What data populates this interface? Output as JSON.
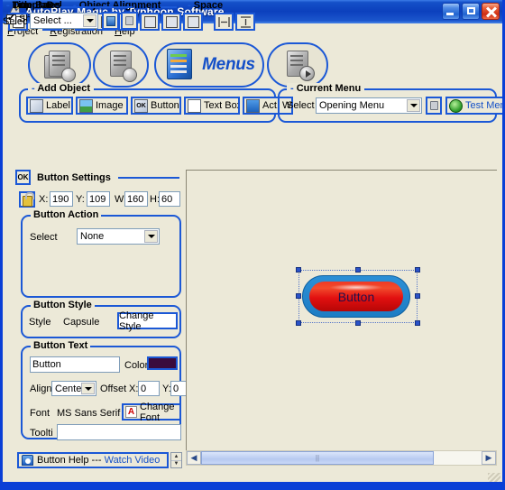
{
  "window": {
    "title": "AutoPlay Magic by Typhoon Software",
    "icon": "app-icon",
    "buttons": {
      "minimize": "minimize-button",
      "maximize": "maximize-button",
      "close": "close-button"
    }
  },
  "menubar": {
    "items": [
      {
        "label": "Project",
        "accel": "P"
      },
      {
        "label": "Registration",
        "accel": "R"
      },
      {
        "label": "Help",
        "accel": "H"
      }
    ]
  },
  "bigbar": {
    "items": [
      {
        "name": "project-icon",
        "label": ""
      },
      {
        "name": "settings-icon",
        "label": ""
      },
      {
        "name": "menus-icon",
        "label": "Menus"
      },
      {
        "name": "preview-icon",
        "label": ""
      }
    ]
  },
  "add_object": {
    "caption": "Add Object",
    "buttons": [
      {
        "label": "Label",
        "icon": "label-icon"
      },
      {
        "label": "Image",
        "icon": "image-icon"
      },
      {
        "label": "Button",
        "icon": "ok-button-icon"
      },
      {
        "label": "Text Box",
        "icon": "textbox-icon"
      },
      {
        "label": "Act. Win",
        "icon": "active-window-icon"
      }
    ]
  },
  "current_menu": {
    "caption": "Current Menu",
    "select_label": "Select",
    "selected": "Opening Menu",
    "options": [
      "Opening Menu"
    ],
    "lock_icon": "lock-icon",
    "test_label": "Test Menu",
    "test_icon": "play-icon"
  },
  "toolrow": {
    "dup": {
      "caption": "Dup",
      "icon": "duplicate-icon"
    },
    "del": {
      "caption": "Del",
      "icon": "delete-icon"
    },
    "align": {
      "caption": "Object Alignment",
      "buttons": [
        "align-left-icon",
        "align-center-horizontal-icon",
        "align-right-icon",
        "align-top-icon",
        "align-middle-vertical-icon",
        "align-bottom-icon"
      ]
    },
    "space": {
      "caption": "Space",
      "buttons": [
        "space-horizontal-icon",
        "space-vertical-icon"
      ]
    },
    "titlebar_group": {
      "caption": "Title Bar",
      "show_label": "Show",
      "show_checked": true,
      "text_value": ""
    },
    "templates": {
      "caption": "Templates",
      "select_label": "Selec",
      "selected": "Select ...",
      "options": [
        "Select ..."
      ],
      "apply_icon": "apply-template-icon",
      "lock_icon": "lock-icon"
    }
  },
  "settings": {
    "badge": "OK",
    "title": "Button Settings",
    "lock_icon": "lock-icon",
    "grid_icon": "grid-snap-icon",
    "geometry": [
      {
        "label": "X:",
        "value": "190"
      },
      {
        "label": "Y:",
        "value": "109"
      },
      {
        "label": "W:",
        "value": "160"
      },
      {
        "label": "H:",
        "value": "60"
      }
    ],
    "action": {
      "caption": "Button Action",
      "select_label": "Select",
      "selected": "None",
      "options": [
        "None"
      ]
    },
    "style": {
      "caption": "Button Style",
      "label": "Style",
      "value": "Capsule",
      "change_label": "Change Style"
    },
    "text": {
      "caption": "Button Text",
      "value": "Button",
      "placeholder": "",
      "color_label": "Color",
      "color_value": "#3a0b3d",
      "align_label": "Align",
      "align_value": "Center",
      "align_options": [
        "Center"
      ],
      "offset_label": "Offset",
      "offset_x_label": "X:",
      "offset_x": "0",
      "offset_y_label": "Y:",
      "offset_y": "0",
      "font_label": "Font",
      "font_value": "MS Sans Serif",
      "change_font_label": "Change Font",
      "tooltip_label": "Toolti",
      "tooltip_value": ""
    }
  },
  "helpbar": {
    "icon": "help-icon",
    "text": "Button Help --- ",
    "link": "Watch Video"
  },
  "canvas": {
    "object": {
      "name": "button-object",
      "label": "Button",
      "style": "Capsule",
      "fill": "#e21010",
      "border": "#1d7dc4",
      "selected": true
    },
    "hscroll_position": "0"
  }
}
